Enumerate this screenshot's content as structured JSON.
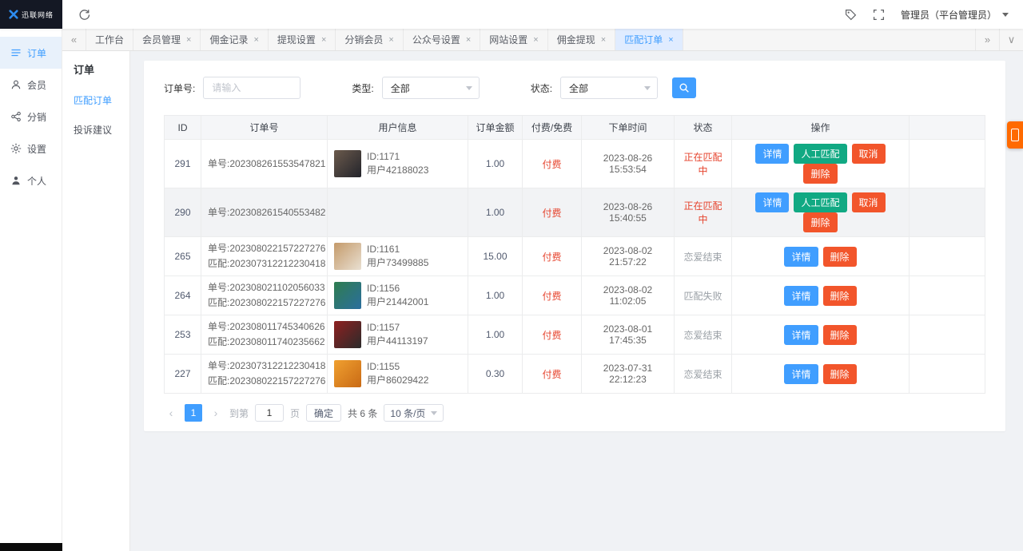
{
  "topbar": {
    "logo": "迅联网络",
    "user_label": "管理员（平台管理员）"
  },
  "primary_nav": {
    "items": [
      {
        "label": "订单",
        "name": "orders",
        "icon": "order-list-icon",
        "active": true
      },
      {
        "label": "会员",
        "name": "members",
        "icon": "member-icon",
        "active": false
      },
      {
        "label": "分销",
        "name": "distribution",
        "icon": "distribution-icon",
        "active": false
      },
      {
        "label": "设置",
        "name": "settings",
        "icon": "settings-icon",
        "active": false
      },
      {
        "label": "个人",
        "name": "profile",
        "icon": "profile-icon",
        "active": false
      }
    ]
  },
  "tabbar": {
    "tabs": [
      {
        "label": "工作台",
        "name": "workbench",
        "closable": false,
        "active": false
      },
      {
        "label": "会员管理",
        "name": "member-manage",
        "closable": true,
        "active": false
      },
      {
        "label": "佣金记录",
        "name": "commission-log",
        "closable": true,
        "active": false
      },
      {
        "label": "提现设置",
        "name": "withdraw-setting",
        "closable": true,
        "active": false
      },
      {
        "label": "分销会员",
        "name": "distributor",
        "closable": true,
        "active": false
      },
      {
        "label": "公众号设置",
        "name": "mp-setting",
        "closable": true,
        "active": false
      },
      {
        "label": "网站设置",
        "name": "site-setting",
        "closable": true,
        "active": false
      },
      {
        "label": "佣金提现",
        "name": "commission-cash",
        "closable": true,
        "active": false
      },
      {
        "label": "匹配订单",
        "name": "match-orders",
        "closable": true,
        "active": true
      }
    ]
  },
  "submenu": {
    "title": "订单",
    "items": [
      {
        "label": "匹配订单",
        "name": "match-orders",
        "active": true
      },
      {
        "label": "投诉建议",
        "name": "complaints",
        "active": false
      }
    ]
  },
  "filters": {
    "order_no": {
      "label": "订单号:",
      "placeholder": "请输入"
    },
    "type": {
      "label": "类型:",
      "value": "全部"
    },
    "status": {
      "label": "状态:",
      "value": "全部"
    }
  },
  "table": {
    "headers": [
      "ID",
      "订单号",
      "用户信息",
      "订单金额",
      "付费/免费",
      "下单时间",
      "状态",
      "操作",
      ""
    ],
    "rows": [
      {
        "id": "291",
        "order_no": "单号:202308261553547821",
        "match_no": "",
        "user_id": "ID:1171",
        "user_name": "用户42188023",
        "avatar": [
          "#6b5a4c",
          "#23242b"
        ],
        "amount": "1.00",
        "fee": "付费",
        "time": "2023-08-26 15:53:54",
        "status": "正在匹配中",
        "status_red": true,
        "actions": [
          {
            "label": "详情",
            "name": "detail",
            "type": "primary"
          },
          {
            "label": "人工匹配",
            "name": "manual-match",
            "type": "success"
          },
          {
            "label": "取消",
            "name": "cancel",
            "type": "danger"
          },
          {
            "label": "删除",
            "name": "delete",
            "type": "danger"
          }
        ]
      },
      {
        "id": "290",
        "order_no": "单号:202308261540553482",
        "match_no": "",
        "user_id": "",
        "user_name": "",
        "avatar": null,
        "amount": "1.00",
        "fee": "付费",
        "time": "2023-08-26 15:40:55",
        "status": "正在匹配中",
        "status_red": true,
        "actions": [
          {
            "label": "详情",
            "name": "detail",
            "type": "primary"
          },
          {
            "label": "人工匹配",
            "name": "manual-match",
            "type": "success"
          },
          {
            "label": "取消",
            "name": "cancel",
            "type": "danger"
          },
          {
            "label": "删除",
            "name": "delete",
            "type": "danger"
          }
        ]
      },
      {
        "id": "265",
        "order_no": "单号:202308022157227276",
        "match_no": "匹配:202307312212230418",
        "user_id": "ID:1161",
        "user_name": "用户73499885",
        "avatar": [
          "#c49a6a",
          "#e9e0d2"
        ],
        "amount": "15.00",
        "fee": "付费",
        "time": "2023-08-02 21:57:22",
        "status": "恋爱结束",
        "status_red": false,
        "actions": [
          {
            "label": "详情",
            "name": "detail",
            "type": "primary"
          },
          {
            "label": "删除",
            "name": "delete",
            "type": "danger"
          }
        ]
      },
      {
        "id": "264",
        "order_no": "单号:202308021102056033",
        "match_no": "匹配:202308022157227276",
        "user_id": "ID:1156",
        "user_name": "用户21442001",
        "avatar": [
          "#2f7d4f",
          "#2b6e9e"
        ],
        "amount": "1.00",
        "fee": "付费",
        "time": "2023-08-02 11:02:05",
        "status": "匹配失败",
        "status_red": false,
        "actions": [
          {
            "label": "详情",
            "name": "detail",
            "type": "primary"
          },
          {
            "label": "删除",
            "name": "delete",
            "type": "danger"
          }
        ]
      },
      {
        "id": "253",
        "order_no": "单号:202308011745340626",
        "match_no": "匹配:202308011740235662",
        "user_id": "ID:1157",
        "user_name": "用户44113197",
        "avatar": [
          "#8f2020",
          "#2b2b2b"
        ],
        "amount": "1.00",
        "fee": "付费",
        "time": "2023-08-01 17:45:35",
        "status": "恋爱结束",
        "status_red": false,
        "actions": [
          {
            "label": "详情",
            "name": "detail",
            "type": "primary"
          },
          {
            "label": "删除",
            "name": "delete",
            "type": "danger"
          }
        ]
      },
      {
        "id": "227",
        "order_no": "单号:202307312212230418",
        "match_no": "匹配:202308022157227276",
        "user_id": "ID:1155",
        "user_name": "用户86029422",
        "avatar": [
          "#f0a030",
          "#c96a15"
        ],
        "amount": "0.30",
        "fee": "付费",
        "time": "2023-07-31 22:12:23",
        "status": "恋爱结束",
        "status_red": false,
        "actions": [
          {
            "label": "详情",
            "name": "detail",
            "type": "primary"
          },
          {
            "label": "删除",
            "name": "delete",
            "type": "danger"
          }
        ]
      }
    ]
  },
  "pagination": {
    "prev": "‹",
    "current": "1",
    "next": "›",
    "jump_label": "到第",
    "jump_value": "1",
    "jump_unit": "页",
    "confirm_label": "确定",
    "total_label": "共 6 条",
    "page_size_label": "10 条/页"
  },
  "glyphs": {
    "collapse_left": "«",
    "expand_right": "»",
    "caret_down": "∨",
    "tab_close": "×"
  },
  "colors": {
    "primary": "#409eff",
    "success": "#11a983",
    "danger": "#f2552b",
    "red": "#e6432d",
    "float": "#ff6a00"
  }
}
